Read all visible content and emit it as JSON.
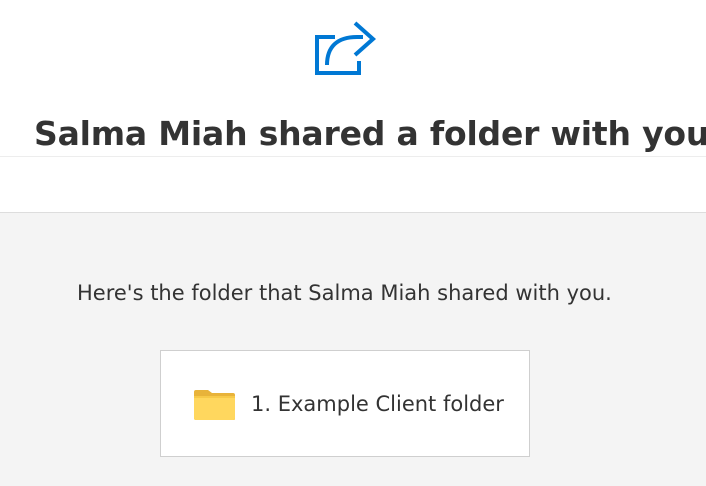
{
  "header": {
    "icon": "share-icon",
    "icon_color": "#0078d4",
    "title": "Salma Miah shared a folder with you"
  },
  "body": {
    "message": "Here's the folder that Salma Miah shared with you."
  },
  "shared_item": {
    "icon": "folder-icon",
    "icon_color": "#f9d45c",
    "name": "1. Example Client folder"
  }
}
